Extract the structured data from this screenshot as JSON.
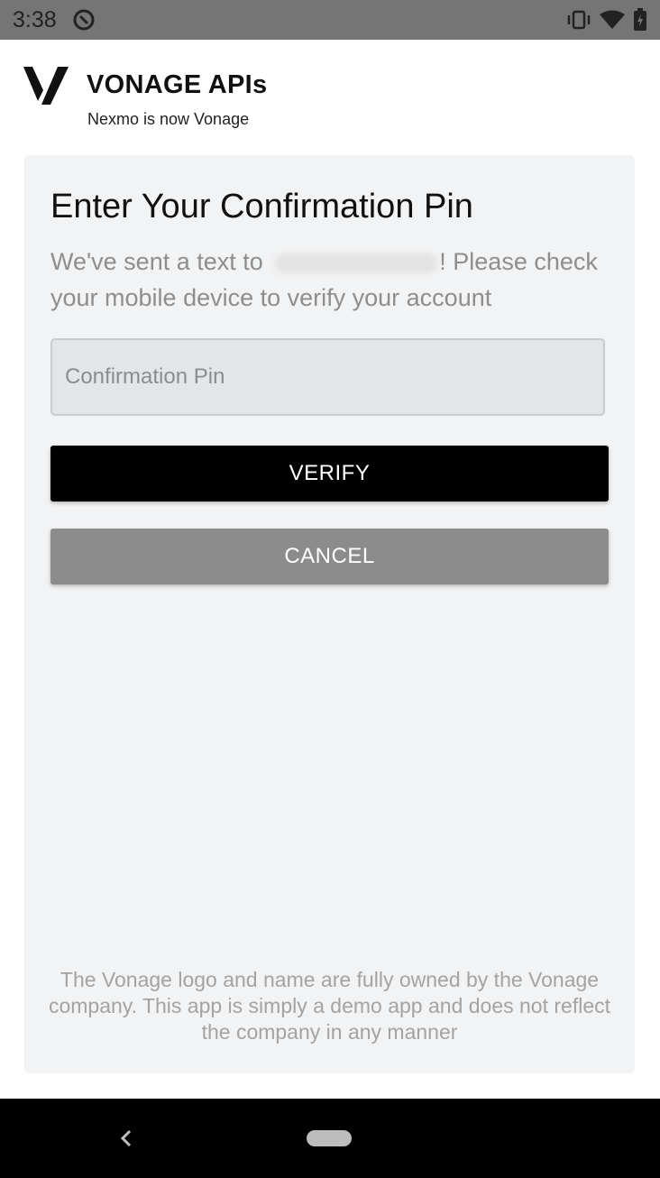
{
  "status_bar": {
    "time": "3:38",
    "icons": [
      "sync-icon",
      "vibrate-icon",
      "wifi-icon",
      "battery-icon"
    ]
  },
  "brand": {
    "name": "VONAGE APIs",
    "tagline": "Nexmo is now Vonage",
    "logo_icon": "vonage-v-logo"
  },
  "verify": {
    "title": "Enter Your Confirmation Pin",
    "message_prefix": "We've sent a text to ",
    "message_suffix": "! Please check your mobile device to verify your account",
    "pin_placeholder": "Confirmation Pin",
    "pin_value": "",
    "verify_label": "VERIFY",
    "cancel_label": "CANCEL"
  },
  "disclaimer": "The Vonage logo and name are fully owned by the Vonage company. This app is simply a demo app and does not reflect the company in any manner",
  "nav_bar": {
    "icons": [
      "back-icon",
      "home-pill-icon"
    ]
  },
  "colors": {
    "status_bar_bg": "#757575",
    "card_bg": "#f2f3f4",
    "verify_button_bg": "#000000",
    "cancel_button_bg": "#8b8c8b",
    "nav_bar_bg": "#000000"
  }
}
